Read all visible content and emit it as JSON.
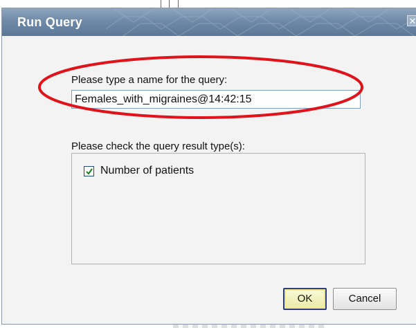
{
  "dialog": {
    "title": "Run Query",
    "close_icon": "close-icon",
    "name_label": "Please type a name for the query:",
    "name_value": "Females_with_migraines@14:42:15",
    "result_types_label": "Please check the query result type(s):",
    "result_types": [
      {
        "label": "Number of patients",
        "checked": true
      }
    ],
    "ok_label": "OK",
    "cancel_label": "Cancel"
  },
  "colors": {
    "titlebar": "#6f8aa7",
    "highlight_ellipse": "#e0131a",
    "ok_border": "#2c3f7a"
  }
}
